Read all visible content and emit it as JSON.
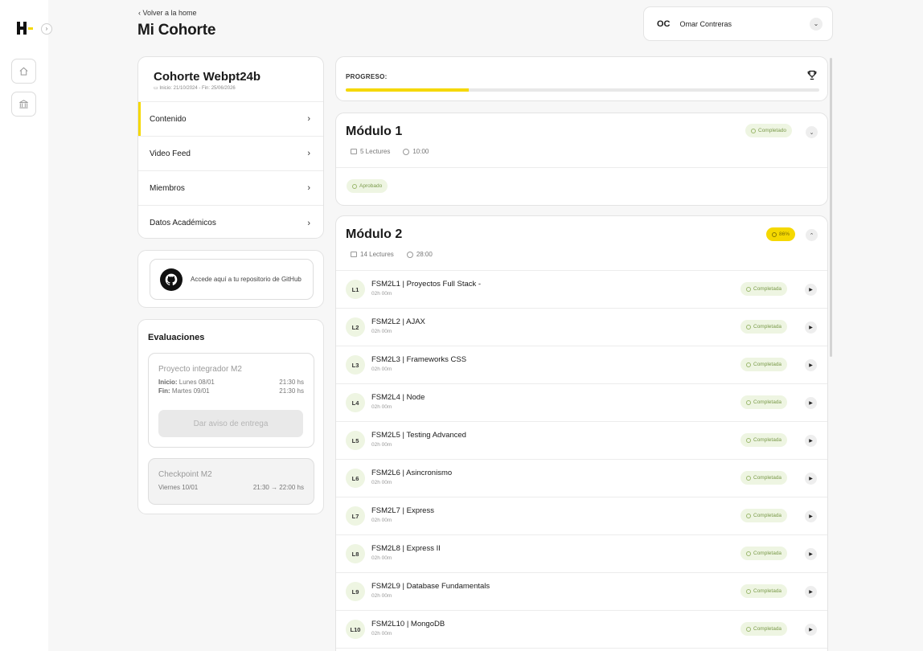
{
  "nav": {
    "back_label": "Volver a la home",
    "page_title": "Mi Cohorte",
    "rail_toggle_glyph": "›"
  },
  "user": {
    "initials": "OC",
    "name": "Omar Contreras",
    "menu_icon": "chevron-down-icon"
  },
  "cohort": {
    "name": "Cohorte Webpt24b",
    "dates": "Inicio: 21/10/2024 - Fin: 25/06/2026",
    "menu": [
      {
        "label": "Contenido",
        "active": true
      },
      {
        "label": "Video Feed",
        "active": false
      },
      {
        "label": "Miembros",
        "active": false
      },
      {
        "label": "Datos Académicos",
        "active": false
      }
    ]
  },
  "github": {
    "text": "Accede aquí a tu repositorio de GitHub"
  },
  "evaluations": {
    "title": "Evaluaciones",
    "items": [
      {
        "name": "Proyecto integrador M2",
        "start_label": "Inicio:",
        "start_date": "Lunes 08/01",
        "start_time": "21:30 hs",
        "end_label": "Fin:",
        "end_date": "Martes 09/01",
        "end_time": "21:30 hs",
        "button": "Dar aviso de entrega"
      },
      {
        "name": "Checkpoint M2",
        "date": "Viernes 10/01",
        "time": "21:30 → 22:00 hs"
      }
    ]
  },
  "progress": {
    "label": "PROGRESO:",
    "fraction": 0.26,
    "fill_color": "#f5d800"
  },
  "modules": [
    {
      "title": "Módulo 1",
      "lectures": "5 Lectures",
      "duration": "10:00",
      "status": "Completado",
      "result": "Aprobado",
      "expanded": false
    },
    {
      "title": "Módulo 2",
      "lectures": "14 Lectures",
      "duration": "28:00",
      "status": "86%",
      "expanded": true,
      "lessons": [
        {
          "num": "L1",
          "title": "FSM2L1 | Proyectos Full Stack -",
          "duration": "02h 00m",
          "status": "Completada"
        },
        {
          "num": "L2",
          "title": "FSM2L2 | AJAX",
          "duration": "02h 00m",
          "status": "Completada"
        },
        {
          "num": "L3",
          "title": "FSM2L3 | Frameworks CSS",
          "duration": "02h 00m",
          "status": "Completada"
        },
        {
          "num": "L4",
          "title": "FSM2L4 | Node",
          "duration": "02h 00m",
          "status": "Completada"
        },
        {
          "num": "L5",
          "title": "FSM2L5 | Testing Advanced",
          "duration": "02h 00m",
          "status": "Completada"
        },
        {
          "num": "L6",
          "title": "FSM2L6 | Asincronismo",
          "duration": "02h 00m",
          "status": "Completada"
        },
        {
          "num": "L7",
          "title": "FSM2L7 | Express",
          "duration": "02h 00m",
          "status": "Completada"
        },
        {
          "num": "L8",
          "title": "FSM2L8 | Express II",
          "duration": "02h 00m",
          "status": "Completada"
        },
        {
          "num": "L9",
          "title": "FSM2L9 | Database Fundamentals",
          "duration": "02h 00m",
          "status": "Completada"
        },
        {
          "num": "L10",
          "title": "FSM2L10 | MongoDB",
          "duration": "02h 00m",
          "status": "Completada"
        }
      ]
    }
  ],
  "colors": {
    "accent": "#f5d800",
    "success_bg": "#eef5e2",
    "success_text": "#7a9a4a"
  }
}
